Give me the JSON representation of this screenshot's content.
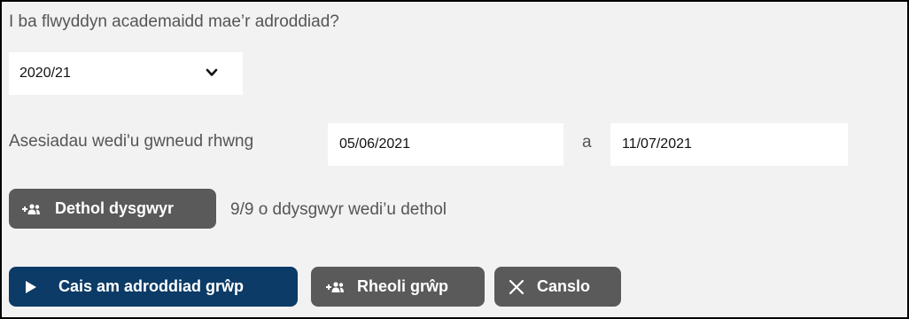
{
  "year_question": "I ba flwyddyn academaidd mae’r adroddiad?",
  "year_select": {
    "selected": "2020/21"
  },
  "date_range": {
    "label": "Asesiadau wedi'u gwneud rhwng",
    "start": "05/06/2021",
    "and_label": "a",
    "end": "11/07/2021"
  },
  "learners": {
    "select_button": "Dethol dysgwyr",
    "status": "9/9 o ddysgwyr wedi’u dethol"
  },
  "actions": {
    "request_report": "Cais am adroddiad grŵp",
    "manage_group": "Rheoli grŵp",
    "cancel": "Canslo"
  },
  "icons": {
    "select_learners": "add-users-icon",
    "request_report": "play-icon",
    "manage_group": "add-users-icon",
    "cancel": "close-icon",
    "dropdown": "chevron-down-icon"
  },
  "colors": {
    "panel_bg": "#f2f2f2",
    "primary_button": "#0b3b66",
    "secondary_button": "#5a5a5a",
    "label_text": "#555555"
  }
}
